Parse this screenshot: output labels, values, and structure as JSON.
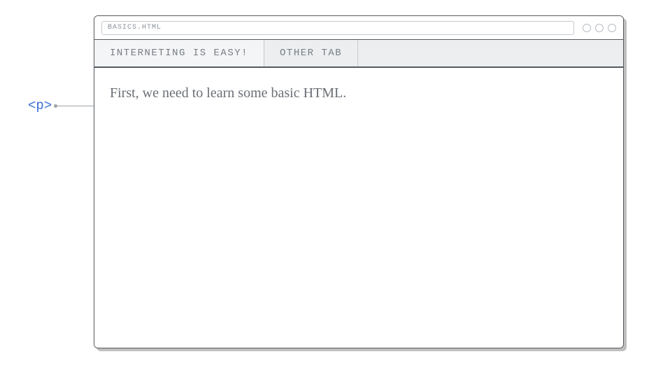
{
  "annotation": {
    "tag_label": "<p>"
  },
  "browser": {
    "url": "BASICS.HTML",
    "tabs": [
      {
        "label": "INTERNETING IS EASY!",
        "active": true
      },
      {
        "label": "OTHER TAB",
        "active": false
      }
    ]
  },
  "content": {
    "paragraph": "First, we need to learn some basic HTML."
  }
}
